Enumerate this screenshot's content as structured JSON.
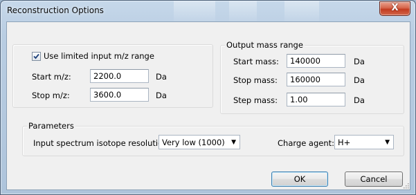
{
  "window": {
    "title": "Reconstruction Options",
    "close_label": "X"
  },
  "input_range": {
    "checkbox_label": "Use limited input m/z range",
    "checked": true,
    "start_label": "Start m/z:",
    "start_value": "2200.0",
    "start_unit": "Da",
    "stop_label": "Stop m/z:",
    "stop_value": "3600.0",
    "stop_unit": "Da"
  },
  "output_range": {
    "legend": "Output mass range",
    "start_label": "Start mass:",
    "start_value": "140000",
    "start_unit": "Da",
    "stop_label": "Stop mass:",
    "stop_value": "160000",
    "stop_unit": "Da",
    "step_label": "Step mass:",
    "step_value": "1.00",
    "step_unit": "Da"
  },
  "parameters": {
    "legend": "Parameters",
    "resolution_label": "Input spectrum isotope resolution:",
    "resolution_value": "Very low (1000)",
    "charge_label": "Charge agent:",
    "charge_value": "H+"
  },
  "buttons": {
    "ok": "OK",
    "cancel": "Cancel"
  }
}
